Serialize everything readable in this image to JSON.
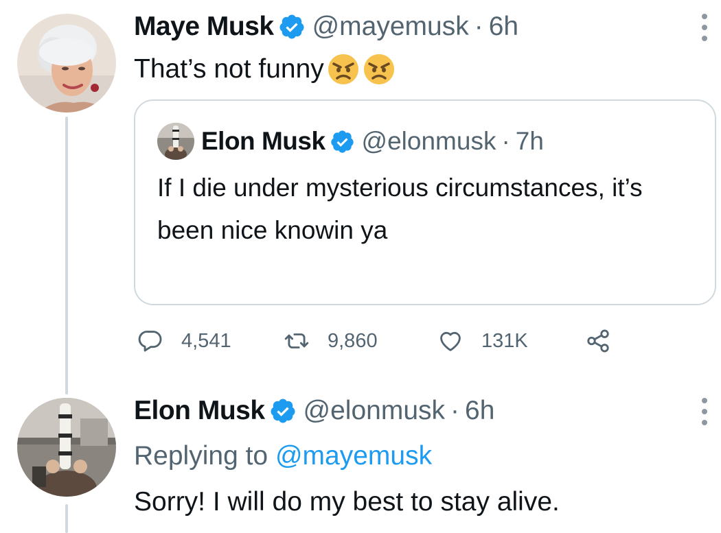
{
  "tweet1": {
    "display_name": "Maye Musk",
    "handle": "@mayemusk",
    "separator": "·",
    "time": "6h",
    "text": "That’s not funny",
    "emojis": [
      "angry-face",
      "angry-face"
    ],
    "quote": {
      "display_name": "Elon Musk",
      "handle": "@elonmusk",
      "separator": "·",
      "time": "7h",
      "text": "If I die under mysterious circumstances, it’s been nice knowin ya"
    },
    "actions": {
      "replies": "4,541",
      "retweets": "9,860",
      "likes": "131K"
    }
  },
  "tweet2": {
    "display_name": "Elon Musk",
    "handle": "@elonmusk",
    "separator": "·",
    "time": "6h",
    "replying_prefix": "Replying to",
    "replying_to": "@mayemusk",
    "text": "Sorry! I will do my best to stay alive."
  },
  "colors": {
    "verified": "#1d9bf0",
    "muted_text": "#536471",
    "link": "#1d9bf0",
    "thread_line": "#cfd9de"
  },
  "icons": {
    "verified": "verified-badge-icon",
    "more": "more-vertical-icon",
    "reply": "reply-icon",
    "retweet": "retweet-icon",
    "like": "heart-icon",
    "share": "share-icon"
  }
}
